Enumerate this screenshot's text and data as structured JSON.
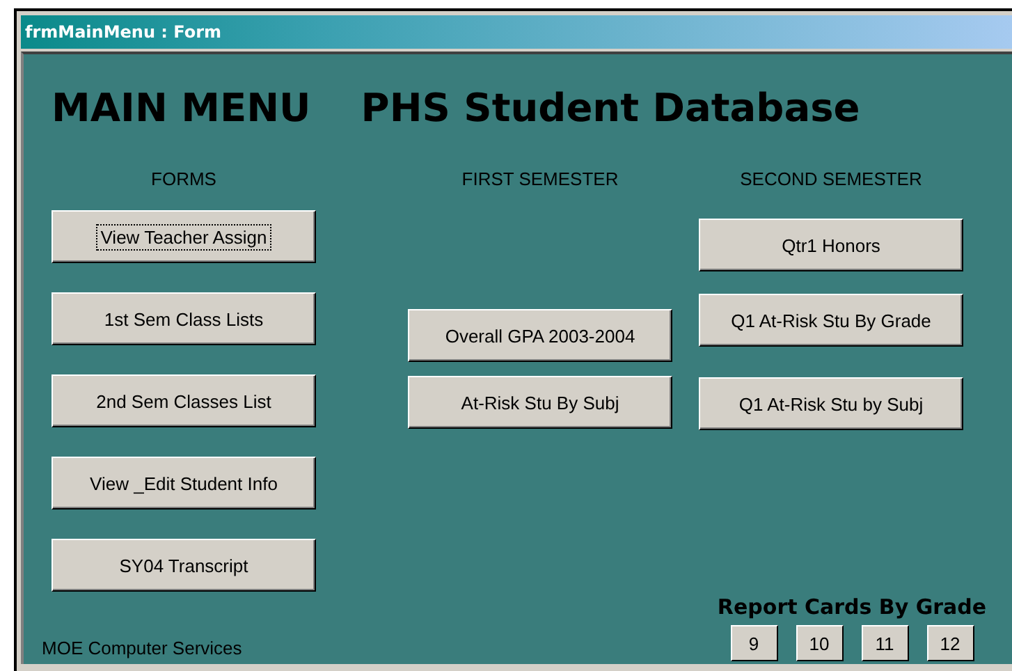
{
  "window": {
    "title": "frmMainMenu : Form"
  },
  "headings": [
    "MAIN MENU",
    "PHS Student Database"
  ],
  "columns": [
    {
      "header": "FORMS",
      "buttons": [
        {
          "label": "View Teacher Assign",
          "focused": true
        },
        {
          "label": "1st Sem Class Lists",
          "focused": false
        },
        {
          "label": "2nd Sem Classes List",
          "focused": false
        },
        {
          "label": "View _Edit Student Info",
          "focused": false
        },
        {
          "label": "SY04 Transcript",
          "focused": false
        }
      ]
    },
    {
      "header": "FIRST SEMESTER",
      "buttons": [
        {
          "label": "Overall GPA 2003-2004",
          "focused": false
        },
        {
          "label": "At-Risk Stu By Subj",
          "focused": false
        }
      ]
    },
    {
      "header": "SECOND SEMESTER",
      "buttons": [
        {
          "label": "Qtr1 Honors",
          "focused": false
        },
        {
          "label": "Q1 At-Risk Stu By Grade",
          "focused": false
        },
        {
          "label": "Q1 At-Risk Stu by Subj",
          "focused": false
        }
      ]
    }
  ],
  "report_cards": {
    "title": "Report Cards By Grade",
    "buttons": [
      "9",
      "10",
      "11",
      "12"
    ]
  },
  "footer": "MOE Computer Services"
}
